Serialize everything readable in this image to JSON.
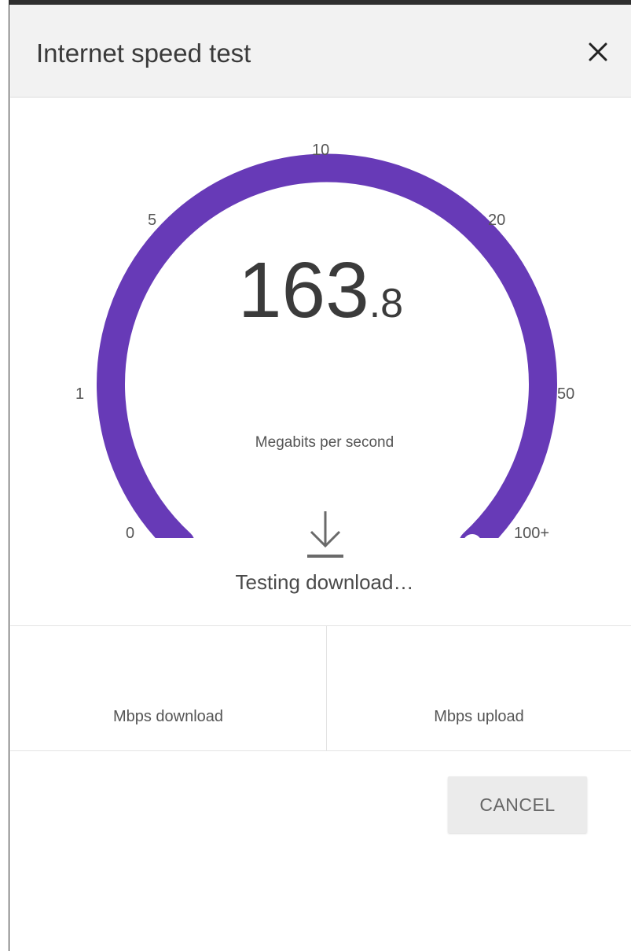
{
  "dialog": {
    "title": "Internet speed test",
    "close_icon": "close-icon"
  },
  "gauge": {
    "ticks": [
      "0",
      "1",
      "5",
      "10",
      "20",
      "50",
      "100+"
    ],
    "arc_color": "#673ab7",
    "speed_integer": "163",
    "speed_decimal": ".8",
    "unit": "Megabits per second",
    "progress": 1.0,
    "status_icon": "download-arrow-icon",
    "status": "Testing download…"
  },
  "results": {
    "download_label": "Mbps download",
    "upload_label": "Mbps upload"
  },
  "actions": {
    "cancel_label": "CANCEL"
  }
}
